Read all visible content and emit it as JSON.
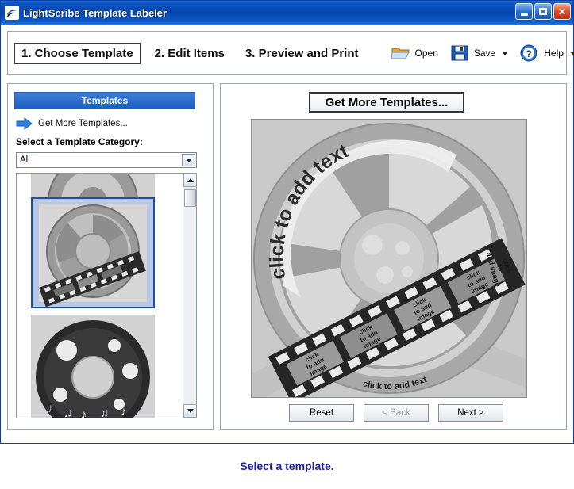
{
  "window": {
    "title": "LightScribe Template Labeler",
    "app_icon": "lightscribe-icon",
    "buttons": {
      "minimize": "minimize-icon",
      "maximize": "maximize-icon",
      "close": "✕"
    }
  },
  "toolbar": {
    "steps": [
      {
        "label": "1. Choose Template",
        "current": true
      },
      {
        "label": "2. Edit Items",
        "current": false
      },
      {
        "label": "3. Preview and Print",
        "current": false
      }
    ],
    "actions": [
      {
        "label": "Open",
        "icon": "folder-open-icon",
        "has_caret": false
      },
      {
        "label": "Save",
        "icon": "floppy-disk-icon",
        "has_caret": true
      },
      {
        "label": "Help",
        "icon": "question-help-icon",
        "has_caret": true
      }
    ]
  },
  "left_panel": {
    "header": "Templates",
    "get_more_link": "Get More Templates...",
    "category_label": "Select a Template Category:",
    "category_value": "All",
    "category_options": [
      "All"
    ],
    "templates": [
      {
        "name": "film-reel-partial",
        "selected": false
      },
      {
        "name": "film-reel-dark",
        "selected": true
      },
      {
        "name": "bubbles-music",
        "selected": false
      }
    ]
  },
  "right_panel": {
    "get_more_button": "Get More Templates...",
    "preview": {
      "name": "film-reel-template-preview",
      "text_items": [
        "click to add text",
        "click to add image",
        "click to add image",
        "click to add image",
        "click to add image",
        "click to add text"
      ]
    },
    "nav": {
      "reset": "Reset",
      "back": "< Back",
      "next": "Next >"
    }
  },
  "status_bar": {
    "message": "Select a template."
  },
  "colors": {
    "title_bar": "#0846ae",
    "accent": "#1d5fc0",
    "status_text": "#1c1c9c",
    "preview_bg": "#c9c9c9"
  }
}
